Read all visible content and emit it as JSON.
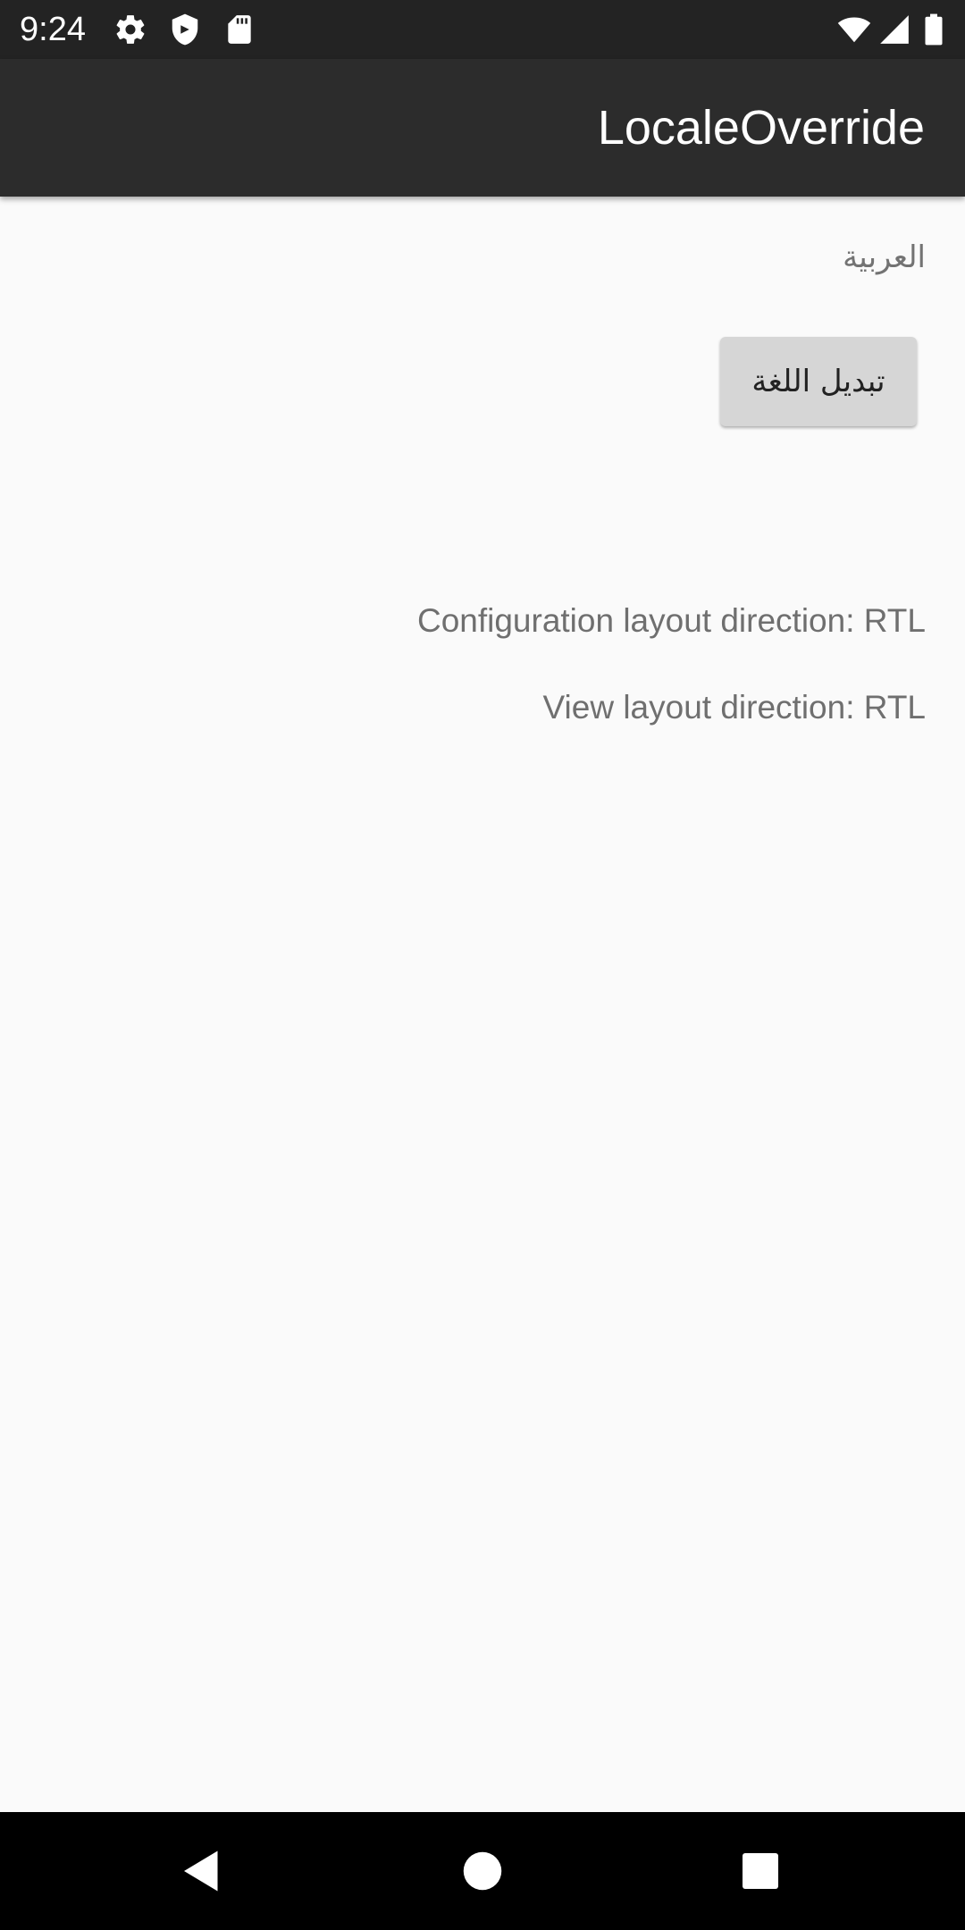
{
  "status_bar": {
    "time": "9:24",
    "icons_left": [
      "gear-icon",
      "shield-icon",
      "sd-card-icon"
    ],
    "icons_right": [
      "wifi-icon",
      "signal-icon",
      "battery-icon"
    ]
  },
  "app_bar": {
    "title": "LocaleOverride"
  },
  "main": {
    "language_label": "العربية",
    "switch_button_label": "تبديل اللغة",
    "configuration_direction": "Configuration layout direction: RTL",
    "view_direction": "View layout direction: RTL"
  },
  "nav_bar": {
    "buttons": [
      "back-icon",
      "home-icon",
      "recents-icon"
    ]
  },
  "colors": {
    "status_bar": "#232323",
    "app_bar": "#2c2c2c",
    "background": "#fafafa",
    "button": "#d6d6d6",
    "secondary_text": "#6f6f6f"
  }
}
